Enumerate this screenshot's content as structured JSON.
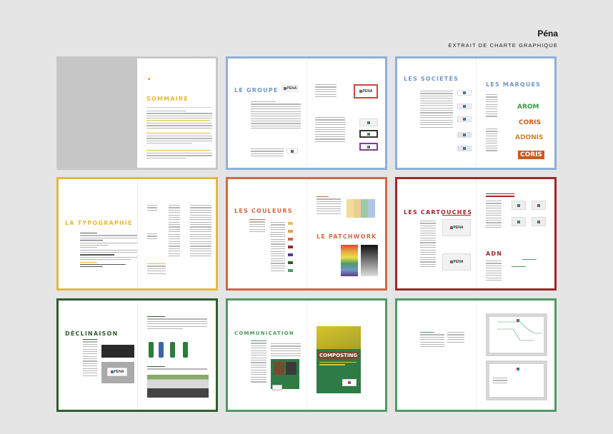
{
  "header": {
    "title": "Péna",
    "subtitle": "EXTRAIT DE CHARTE GRAPHIQUE"
  },
  "colors": {
    "page1": "#c8c8c8",
    "page2": "#8fb0d8",
    "page3": "#8fb0d8",
    "page4": "#e5b93c",
    "page5": "#d3683e",
    "page6": "#a1262b",
    "page7": "#2d5e2f",
    "page8": "#4f9a63",
    "page9": "#4f9a63"
  },
  "pages": [
    {
      "title": "SOMMAIRE"
    },
    {
      "title": "LE GROUPE",
      "logo_text": "PENA"
    },
    {
      "title": "LES SOCIÉTÉS",
      "title2": "LES MARQUES",
      "brands": [
        "AROM",
        "CORIS",
        "ADONIS",
        "CORIS"
      ]
    },
    {
      "title": "LA TYPOGRAPHIE"
    },
    {
      "title": "LES COULEURS",
      "title2": "LE PATCHWORK"
    },
    {
      "title": "LES CARTOUCHES",
      "title2": "ADN"
    },
    {
      "title": "DÉCLINAISON"
    },
    {
      "title": "COMMUNICATION",
      "poster_title": "COMPOSTING"
    },
    {
      "title": ""
    }
  ]
}
